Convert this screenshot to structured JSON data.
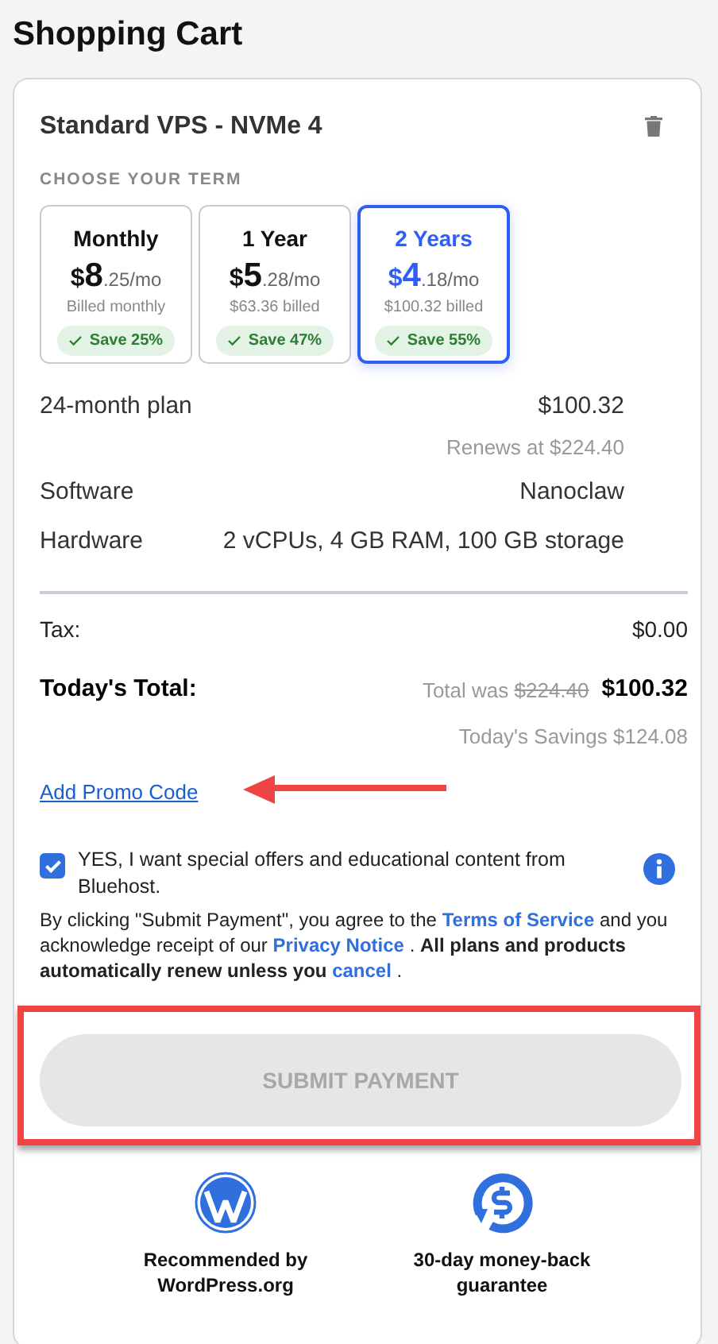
{
  "page_title": "Shopping Cart",
  "product": {
    "name": "Standard VPS - NVMe 4"
  },
  "term_heading": "CHOOSE YOUR TERM",
  "terms": [
    {
      "label": "Monthly",
      "currency": "$",
      "price_main": "8",
      "price_rest": ".25/mo",
      "billed": "Billed monthly",
      "savings": "Save 25%",
      "selected": false
    },
    {
      "label": "1 Year",
      "currency": "$",
      "price_main": "5",
      "price_rest": ".28/mo",
      "billed": "$63.36 billed",
      "savings": "Save 47%",
      "selected": false
    },
    {
      "label": "2 Years",
      "currency": "$",
      "price_main": "4",
      "price_rest": ".18/mo",
      "billed": "$100.32 billed",
      "savings": "Save 55%",
      "selected": true
    }
  ],
  "details": [
    {
      "label": "24-month plan",
      "value": "$100.32",
      "note": "Renews at $224.40"
    },
    {
      "label": "Software",
      "value": "Nanoclaw"
    },
    {
      "label": "Hardware",
      "value": "2 vCPUs, 4 GB RAM, 100 GB storage"
    }
  ],
  "tax": {
    "label": "Tax:",
    "value": "$0.00"
  },
  "total": {
    "label": "Today's Total:",
    "was_label": "Total was",
    "was_value": "$224.40",
    "value": "$100.32"
  },
  "savings": "Today's Savings $124.08",
  "promo_link": "Add Promo Code",
  "optin": {
    "checked": true,
    "text": "YES, I want special offers and educational content from Bluehost."
  },
  "legal": [
    {
      "kind": "text",
      "text": "By clicking \"Submit Payment\", you agree to the"
    },
    {
      "kind": "link",
      "text": "Terms of Service"
    },
    {
      "kind": "text",
      "text": "and you acknowledge receipt of our"
    },
    {
      "kind": "link",
      "text": "Privacy Notice"
    },
    {
      "kind": "text",
      "text": "."
    },
    {
      "kind": "bold",
      "text": "All plans and products automatically renew unless you"
    },
    {
      "kind": "link",
      "text": "cancel"
    },
    {
      "kind": "text",
      "text": "."
    }
  ],
  "submit": {
    "label": "SUBMIT PAYMENT",
    "disabled": true
  },
  "badges": [
    {
      "kind": "wordpress",
      "text": "Recommended by WordPress.org"
    },
    {
      "kind": "money_back",
      "text": "30-day money-back guarantee"
    }
  ]
}
